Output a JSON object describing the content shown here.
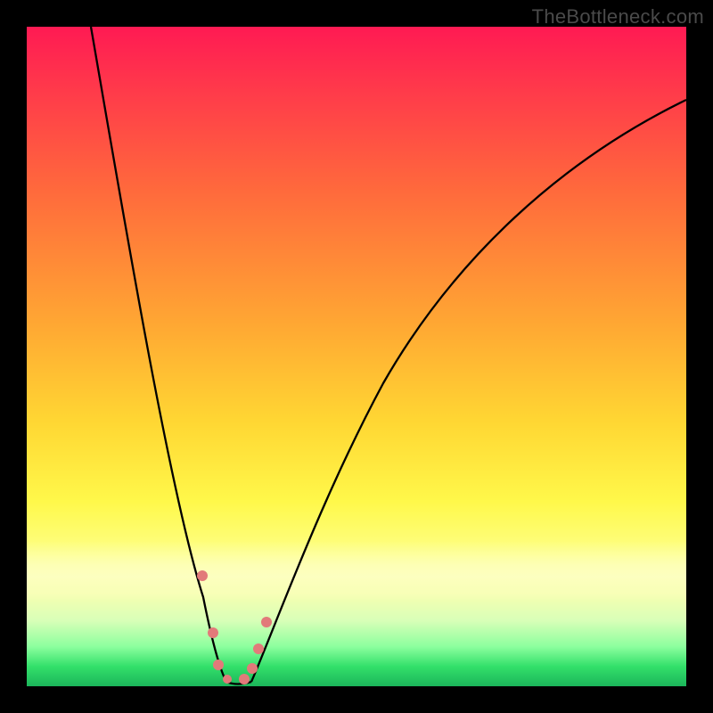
{
  "watermark": "TheBottleneck.com",
  "chart_data": {
    "type": "line",
    "title": "",
    "xlabel": "",
    "ylabel": "",
    "xlim": [
      0,
      100
    ],
    "ylim": [
      0,
      100
    ],
    "gradient_stops": [
      {
        "pct": 0,
        "color": "#ff1a53"
      },
      {
        "pct": 10,
        "color": "#ff3b4a"
      },
      {
        "pct": 25,
        "color": "#ff6a3c"
      },
      {
        "pct": 45,
        "color": "#ffa733"
      },
      {
        "pct": 60,
        "color": "#ffd733"
      },
      {
        "pct": 72,
        "color": "#fff84a"
      },
      {
        "pct": 80,
        "color": "#fdff86"
      },
      {
        "pct": 86,
        "color": "#f6ffb0"
      },
      {
        "pct": 90,
        "color": "#d9ffb8"
      },
      {
        "pct": 94,
        "color": "#8cff9e"
      },
      {
        "pct": 97,
        "color": "#33e06a"
      },
      {
        "pct": 100,
        "color": "#1bb55a"
      }
    ],
    "series": [
      {
        "name": "left-branch",
        "x": [
          10,
          12,
          14,
          16,
          18,
          20,
          22,
          24,
          26,
          28,
          29,
          30
        ],
        "y": [
          100,
          90,
          80,
          70,
          60,
          50,
          40,
          30,
          20,
          10,
          5,
          2
        ]
      },
      {
        "name": "right-branch",
        "x": [
          34,
          36,
          40,
          45,
          50,
          55,
          60,
          70,
          80,
          90,
          100
        ],
        "y": [
          2,
          8,
          20,
          35,
          47,
          56,
          63,
          73,
          80,
          85,
          89
        ]
      }
    ],
    "floor": {
      "x": [
        30,
        34
      ],
      "y": [
        2,
        2
      ]
    },
    "markers": [
      {
        "x": 26.5,
        "y": 17,
        "r": 6
      },
      {
        "x": 28.2,
        "y": 8,
        "r": 6
      },
      {
        "x": 29.0,
        "y": 3,
        "r": 6
      },
      {
        "x": 30.5,
        "y": 1.5,
        "r": 5
      },
      {
        "x": 33.0,
        "y": 1.5,
        "r": 6
      },
      {
        "x": 34.2,
        "y": 3,
        "r": 6
      },
      {
        "x": 35.0,
        "y": 6,
        "r": 6
      },
      {
        "x": 36.3,
        "y": 10,
        "r": 6
      }
    ],
    "marker_color": "#e57373"
  }
}
